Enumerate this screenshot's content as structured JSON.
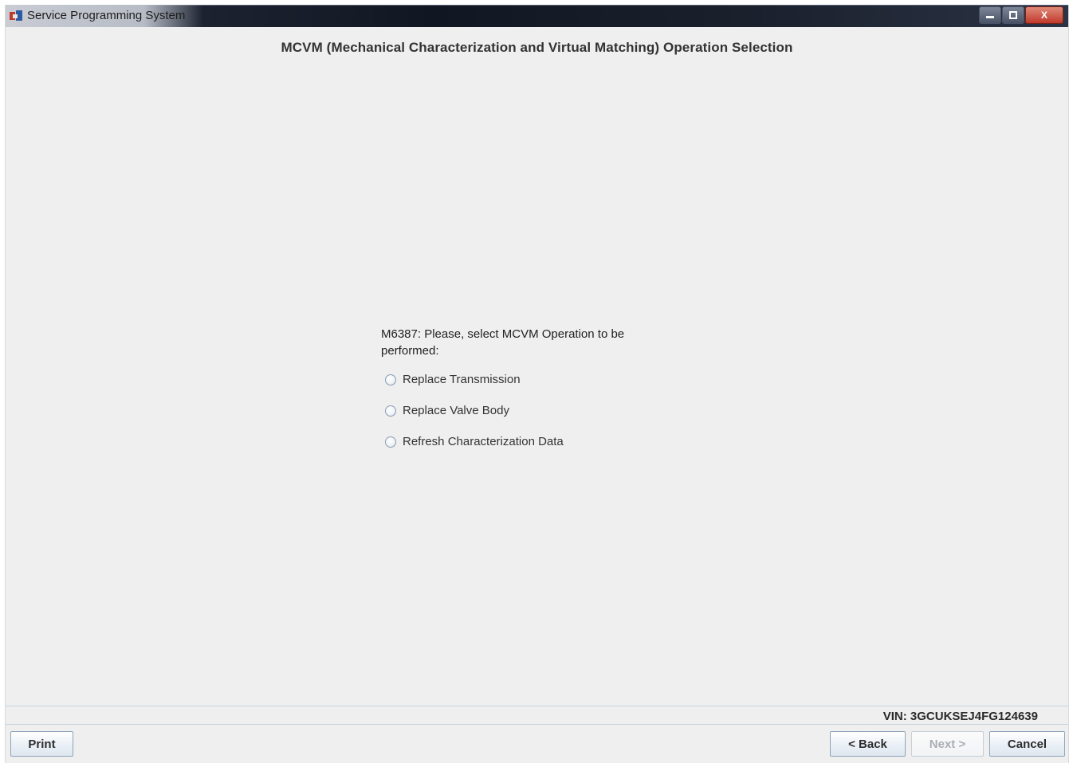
{
  "window": {
    "title": "Service Programming System",
    "controls": {
      "minimize_icon": "minimize-icon",
      "maximize_icon": "maximize-icon",
      "close_label": "X"
    }
  },
  "page": {
    "title": "MCVM (Mechanical Characterization and Virtual Matching) Operation Selection",
    "prompt": "M6387: Please, select MCVM Operation to be performed:",
    "options": [
      {
        "label": "Replace Transmission",
        "selected": false
      },
      {
        "label": "Replace Valve Body",
        "selected": false
      },
      {
        "label": "Refresh Characterization Data",
        "selected": false
      }
    ]
  },
  "footer": {
    "vin": "VIN: 3GCUKSEJ4FG124639",
    "print_label": "Print",
    "back_label": "< Back",
    "next_label": "Next >",
    "cancel_label": "Cancel",
    "next_enabled": false
  },
  "colors": {
    "background": "#efefef",
    "titlebar": "#111722",
    "button_border": "#8ea3ba",
    "disabled_text": "#a9aeb4"
  }
}
